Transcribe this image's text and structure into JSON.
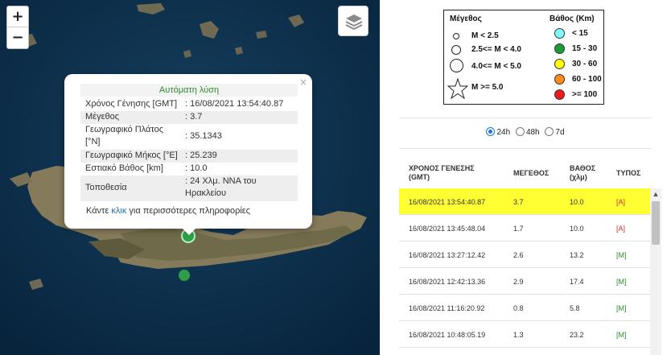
{
  "map": {
    "zoom_in_label": "+",
    "zoom_out_label": "−",
    "layers_icon": "layers-icon",
    "popup": {
      "title": "Αυτόματη λύση",
      "close_label": "×",
      "rows": [
        {
          "key": "Χρόνος Γένησης [GMT]",
          "value": ": 16/08/2021 13:54:40.87"
        },
        {
          "key": "Μέγεθος",
          "value": ": 3.7"
        },
        {
          "key": "Γεωγραφικό Πλάτος [°N]",
          "value": ": 35.1343"
        },
        {
          "key": "Γεωγραφικό Μήκος [°E]",
          "value": ": 25.239"
        },
        {
          "key": "Εστιακό Βάθος [km]",
          "value": ": 10.0"
        },
        {
          "key": "Τοποθεσία",
          "value": ": 24 Χλμ. ΝΝΑ του Ηρακλείου"
        }
      ],
      "footer_before": "Κάντε ",
      "footer_link": "κλικ",
      "footer_after": " για περισσότερες πληροφορίες"
    },
    "markers": [
      {
        "color": "#2e9e4a",
        "selected": true
      },
      {
        "color": "#2e9e4a",
        "selected": false
      }
    ]
  },
  "legend": {
    "magnitude_title": "Μέγεθος",
    "depth_title": "Βάθος (Km)",
    "magnitudes": [
      "M < 2.5",
      "2.5<= M < 4.0",
      "4.0<= M < 5.0",
      "M >= 5.0"
    ],
    "depths": [
      {
        "label": "< 15",
        "color": "#7fffff"
      },
      {
        "label": "15 - 30",
        "color": "#1f9a3a"
      },
      {
        "label": "30 - 60",
        "color": "#ffff00"
      },
      {
        "label": "60 - 100",
        "color": "#ff8c1a"
      },
      {
        "label": ">= 100",
        "color": "#e81c1c"
      }
    ]
  },
  "periods": [
    {
      "label": "24h",
      "selected": true
    },
    {
      "label": "48h",
      "selected": false
    },
    {
      "label": "7d",
      "selected": false
    }
  ],
  "table": {
    "headers": {
      "time_1": "ΧΡΟΝΟΣ ΓΕΝΕΣΗΣ",
      "time_2": "(GMT)",
      "magnitude": "ΜΕΓΕΘΟΣ",
      "depth_1": "ΒΑΘΟΣ",
      "depth_2": "(χλμ)",
      "type": "ΤΥΠΟΣ"
    },
    "rows": [
      {
        "time": "16/08/2021 13:54:40.87",
        "magnitude": "3.7",
        "depth": "10.0",
        "type": "[A]",
        "highlight": true
      },
      {
        "time": "16/08/2021 13:45:48.04",
        "magnitude": "1.7",
        "depth": "10.0",
        "type": "[A]",
        "highlight": false
      },
      {
        "time": "16/08/2021 13:27:12.42",
        "magnitude": "2.6",
        "depth": "13.2",
        "type": "[M]",
        "highlight": false
      },
      {
        "time": "16/08/2021 12:42:13.36",
        "magnitude": "2.9",
        "depth": "17.4",
        "type": "[M]",
        "highlight": false
      },
      {
        "time": "16/08/2021 11:16:20.92",
        "magnitude": "0.8",
        "depth": "5.8",
        "type": "[M]",
        "highlight": false
      },
      {
        "time": "16/08/2021 10:48:05.19",
        "magnitude": "1.3",
        "depth": "23.2",
        "type": "[M]",
        "highlight": false
      }
    ]
  }
}
